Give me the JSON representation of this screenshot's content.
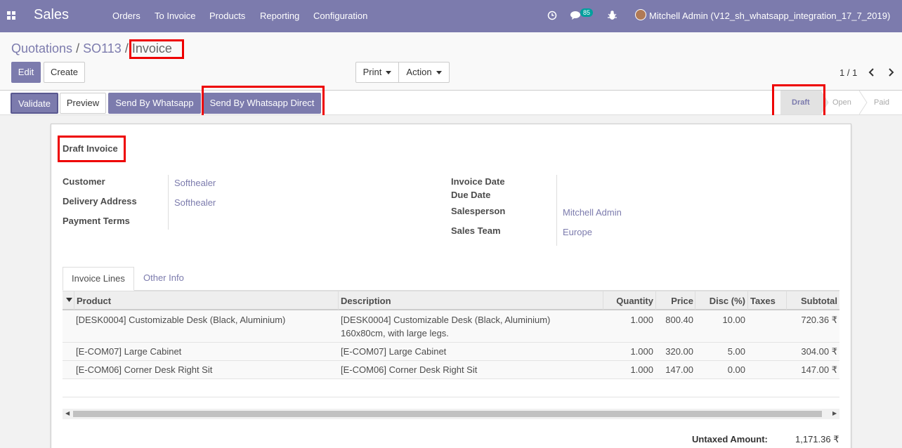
{
  "navbar": {
    "app": "Sales",
    "menu": [
      "Orders",
      "To Invoice",
      "Products",
      "Reporting",
      "Configuration"
    ],
    "message_count": "85",
    "user": "Mitchell Admin (V12_sh_whatsapp_integration_17_7_2019)"
  },
  "breadcrumb": {
    "quotations": "Quotations",
    "sep1": "/",
    "order": "SO113",
    "sep2": "/",
    "current": "Invoice"
  },
  "buttons": {
    "edit": "Edit",
    "create": "Create",
    "print": "Print",
    "action": "Action",
    "validate": "Validate",
    "preview": "Preview",
    "send_whatsapp": "Send By Whatsapp",
    "send_whatsapp_direct": "Send By Whatsapp Direct"
  },
  "pager": {
    "value": "1 / 1"
  },
  "status": {
    "steps": [
      "Draft",
      "Open",
      "Paid"
    ],
    "active": "Draft"
  },
  "invoice": {
    "title": "Draft Invoice",
    "labels": {
      "customer": "Customer",
      "delivery": "Delivery Address",
      "payment_terms": "Payment Terms",
      "invoice_date": "Invoice Date",
      "due_date": "Due Date",
      "salesperson": "Salesperson",
      "sales_team": "Sales Team"
    },
    "customer": "Softhealer",
    "delivery": "Softhealer",
    "salesperson": "Mitchell Admin",
    "sales_team": "Europe"
  },
  "tabs": [
    "Invoice Lines",
    "Other Info"
  ],
  "table": {
    "headers": [
      "Product",
      "Description",
      "Quantity",
      "Price",
      "Disc (%)",
      "Taxes",
      "Subtotal"
    ],
    "rows": [
      {
        "product": "[DESK0004] Customizable Desk (Black, Aluminium)",
        "desc1": "[DESK0004] Customizable Desk (Black, Aluminium)",
        "desc2": "160x80cm, with large legs.",
        "qty": "1.000",
        "price": "800.40",
        "disc": "10.00",
        "subtotal": "720.36 ₹"
      },
      {
        "product": "[E-COM07] Large Cabinet",
        "desc1": "[E-COM07] Large Cabinet",
        "qty": "1.000",
        "price": "320.00",
        "disc": "5.00",
        "subtotal": "304.00 ₹"
      },
      {
        "product": "[E-COM06] Corner Desk Right Sit",
        "desc1": "[E-COM06] Corner Desk Right Sit",
        "qty": "1.000",
        "price": "147.00",
        "disc": "0.00",
        "subtotal": "147.00 ₹"
      }
    ]
  },
  "totals": {
    "untaxed_label": "Untaxed Amount:",
    "untaxed_value": "1,171.36 ₹"
  },
  "colors": {
    "brand": "#7c7bad",
    "highlight": "#e00000",
    "badge": "#00a09d"
  }
}
